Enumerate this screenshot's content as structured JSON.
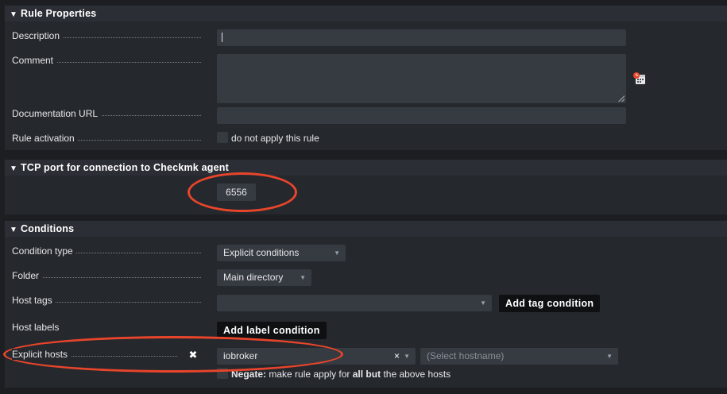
{
  "sections": {
    "rule_properties": "Rule Properties",
    "tcp_port": "TCP port for connection to Checkmk agent",
    "conditions": "Conditions"
  },
  "rule_properties": {
    "description_label": "Description",
    "description_value": "",
    "comment_label": "Comment",
    "comment_value": "",
    "doc_url_label": "Documentation URL",
    "doc_url_value": "",
    "activation_label": "Rule activation",
    "activation_checkbox": "do not apply this rule"
  },
  "tcp_port": {
    "value": "6556"
  },
  "conditions": {
    "condition_type_label": "Condition type",
    "condition_type_value": "Explicit conditions",
    "folder_label": "Folder",
    "folder_value": "Main directory",
    "host_tags_label": "Host tags",
    "add_tag_button": "Add tag condition",
    "host_labels_label": "Host labels",
    "add_label_button": "Add label condition",
    "explicit_hosts_label": "Explicit hosts",
    "host_value": "iobroker",
    "hostname_placeholder": "(Select hostname)",
    "negate_bold": "Negate:",
    "negate_text_1": "make rule apply for",
    "negate_bold_2": "all but",
    "negate_text_2": "the above hosts"
  },
  "colors": {
    "annotation": "#e8452b",
    "background": "#1c1e22",
    "panel": "#25282d",
    "input": "#363a41"
  },
  "icons": [
    "collapse-triangle-icon",
    "insert-timestamp-icon",
    "clear-x-icon",
    "remove-x-icon",
    "dropdown-caret-icon"
  ]
}
